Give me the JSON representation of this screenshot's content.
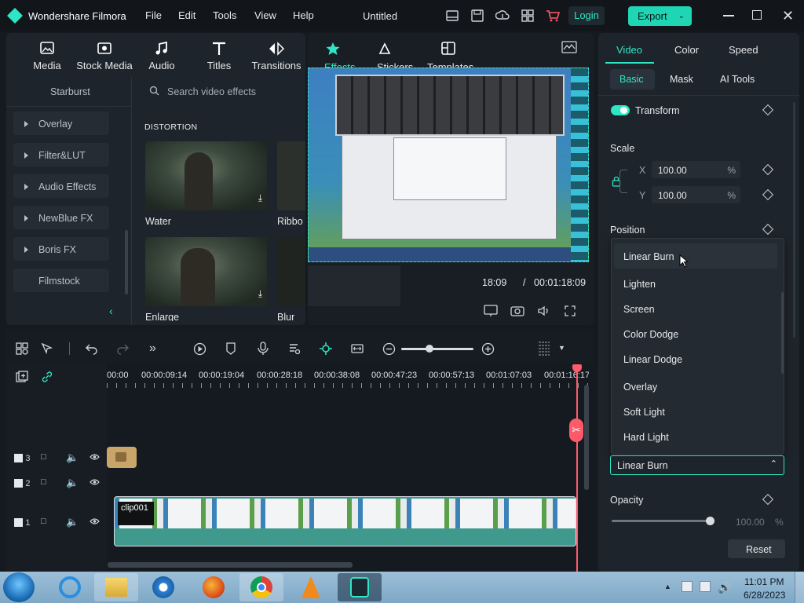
{
  "app": {
    "title": "Wondershare Filmora",
    "project": "Untitled",
    "login": "Login",
    "export": "Export"
  },
  "menu": [
    "File",
    "Edit",
    "Tools",
    "View",
    "Help"
  ],
  "toolbar": {
    "tabs": [
      "Media",
      "Stock Media",
      "Audio",
      "Titles",
      "Transitions"
    ],
    "preview_tabs": [
      "Effects",
      "Stickers",
      "Templates"
    ]
  },
  "sidebar": {
    "header": "Starburst",
    "items": [
      "Overlay",
      "Filter&LUT",
      "Audio Effects",
      "NewBlue FX",
      "Boris FX",
      "Filmstock"
    ]
  },
  "effects": {
    "search_placeholder": "Search video effects",
    "section": "DISTORTION",
    "items": [
      "Water",
      "Ribbo",
      "Enlarge",
      "Blur"
    ]
  },
  "preview": {
    "current_time": "18:09",
    "separator": "/",
    "total_time": "00:01:18:09"
  },
  "properties": {
    "tabs": [
      "Video",
      "Color",
      "Speed"
    ],
    "subtabs": [
      "Basic",
      "Mask",
      "AI Tools"
    ],
    "transform": "Transform",
    "scale": "Scale",
    "x_label": "X",
    "x_value": "100.00",
    "y_label": "Y",
    "y_value": "100.00",
    "percent": "%",
    "position": "Position",
    "blend_options": [
      "Linear Burn",
      "Lighten",
      "Screen",
      "Color Dodge",
      "Linear Dodge",
      "Overlay",
      "Soft Light",
      "Hard Light"
    ],
    "blend_selected": "Linear Burn",
    "opacity": "Opacity",
    "opacity_value": "100.00",
    "reset": "Reset"
  },
  "timeline": {
    "ruler": [
      "00:00",
      "00:00:09:14",
      "00:00:19:04",
      "00:00:28:18",
      "00:00:38:08",
      "00:00:47:23",
      "00:00:57:13",
      "00:01:07:03",
      "00:01:16:17"
    ],
    "tracks": [
      "3",
      "2",
      "1"
    ],
    "clip_name": "clip001"
  },
  "taskbar": {
    "time": "11:01 PM",
    "date": "6/28/2023"
  },
  "colors": {
    "accent": "#2ee6c4",
    "playhead": "#ff5a6a",
    "export": "#1fd6b4",
    "clip": "#3f9a8d"
  }
}
